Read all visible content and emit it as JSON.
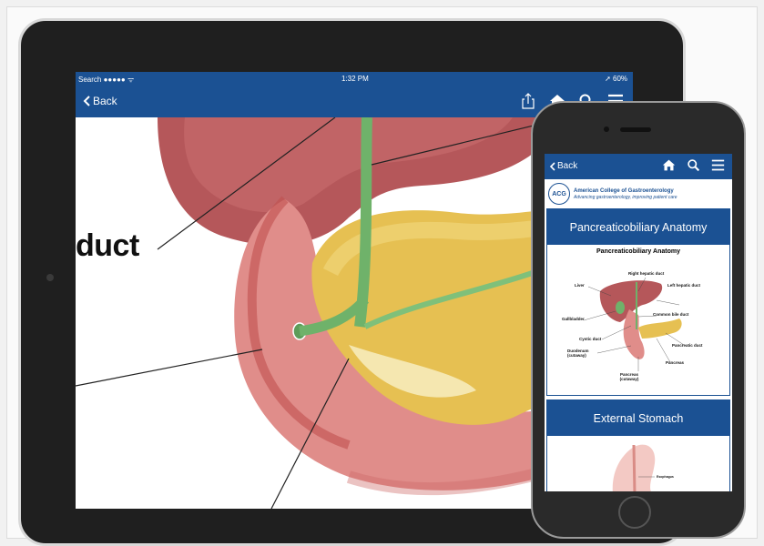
{
  "tablet": {
    "status": {
      "carrier": "Search ●●●●● ᯤ",
      "time": "1:32 PM",
      "battery": "➚ 60%"
    },
    "nav": {
      "back_label": "Back",
      "icons": [
        "share-icon",
        "home-icon",
        "search-icon",
        "menu-icon"
      ]
    },
    "figure_label": "duct"
  },
  "phone": {
    "nav": {
      "back_label": "Back",
      "icons": [
        "home-icon",
        "search-icon",
        "menu-icon"
      ]
    },
    "org": {
      "name": "American College of Gastroenterology",
      "tagline": "Advancing gastroenterology, improving patient care",
      "logo_text": "ACG"
    },
    "cards": [
      {
        "title": "Pancreaticobiliary Anatomy",
        "image_title": "Pancreaticobiliary Anatomy",
        "labels": [
          "Right hepatic duct",
          "Liver",
          "Left hepatic duct",
          "Gallbladder",
          "Common bile duct",
          "Cystic duct",
          "Duodenum (cutaway)",
          "Pancreatic duct",
          "Pancreas",
          "Pancreas (cutaway)"
        ]
      },
      {
        "title": "External Stomach",
        "labels": [
          "Esophagus"
        ]
      }
    ]
  },
  "colors": {
    "brand_blue": "#1b5193"
  }
}
